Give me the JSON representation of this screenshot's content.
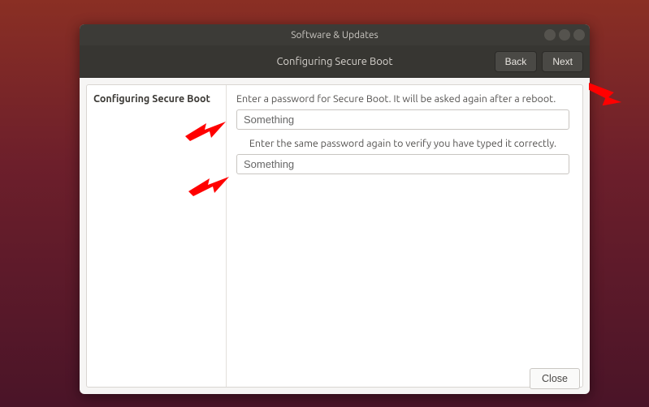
{
  "window": {
    "title": "Software & Updates"
  },
  "nav": {
    "heading": "Configuring Secure Boot",
    "back_label": "Back",
    "next_label": "Next"
  },
  "content": {
    "side_title": "Configuring Secure Boot",
    "instruction1": "Enter a password for Secure Boot. It will be asked again after a reboot.",
    "password1": "Something",
    "instruction2": "Enter the same password again to verify you have typed it correctly.",
    "password2": "Something"
  },
  "footer": {
    "close_label": "Close"
  }
}
